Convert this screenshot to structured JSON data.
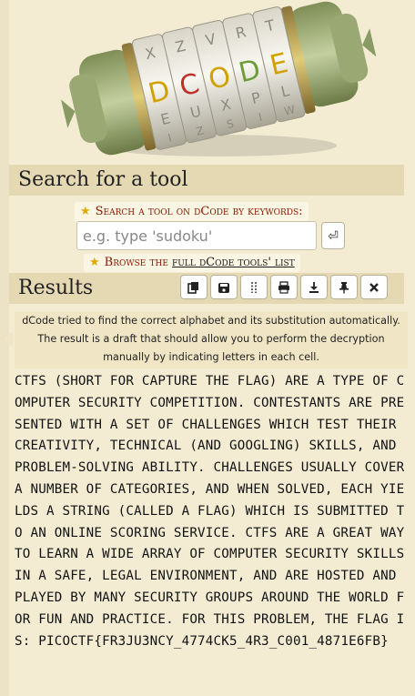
{
  "logo": {
    "brand_letters": [
      "D",
      "C",
      "O",
      "D",
      "E"
    ],
    "brand_colors": [
      "#d2a100",
      "#c0302a",
      "#d2a100",
      "#6f9c3a",
      "#d2a100"
    ]
  },
  "search_section": {
    "title": "Search for a tool",
    "label": "Search a tool on dCode by keywords:",
    "input_value": "",
    "input_placeholder": "e.g. type 'sudoku'",
    "go_icon": "enter-arrow-icon",
    "browse_prefix": "Browse the",
    "browse_link": "full dCode tools' list"
  },
  "results_section": {
    "title": "Results",
    "toolbar_icons": [
      "copy-icon",
      "save-icon",
      "split-icon",
      "print-icon",
      "download-icon",
      "pin-icon",
      "close-icon"
    ],
    "note": "dCode tried to find the correct alphabet and its substitution automatically. The result is a draft that should allow you to perform the decryption manually by indicating letters in each cell.",
    "output": "CTFS (SHORT FOR CAPTURE THE FLAG) ARE A TYPE OF COMPUTER SECURITY COMPETITION. CONTESTANTS ARE PRESENTED WITH A SET OF CHALLENGES WHICH TEST THEIR CREATIVITY, TECHNICAL (AND GOOGLING) SKILLS, AND PROBLEM-SOLVING ABILITY. CHALLENGES USUALLY COVER A NUMBER OF CATEGORIES, AND WHEN SOLVED, EACH YIELDS A STRING (CALLED A FLAG) WHICH IS SUBMITTED TO AN ONLINE SCORING SERVICE. CTFS ARE A GREAT WAY TO LEARN A WIDE ARRAY OF COMPUTER SECURITY SKILLS IN A SAFE, LEGAL ENVIRONMENT, AND ARE HOSTED AND PLAYED BY MANY SECURITY GROUPS AROUND THE WORLD FOR FUN AND PRACTICE. FOR THIS PROBLEM, THE FLAG IS: PICOCTF{FR3JU3NCY_4774CK5_4R3_C001_4871E6FB}"
  },
  "colors": {
    "page_bg": "#f3ecd3",
    "title_bar": "#e5d9b4",
    "accent_red": "#8b1500",
    "star": "#e0a800"
  }
}
